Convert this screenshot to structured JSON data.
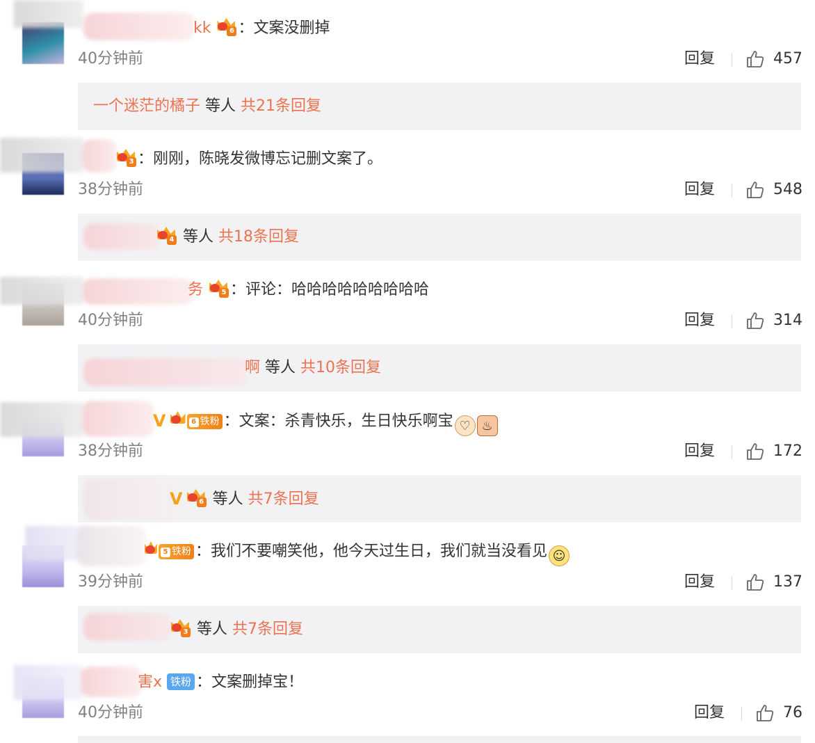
{
  "comments": [
    {
      "name_visible": "kk",
      "badge_level": "6",
      "text": "文案没删掉",
      "time": "40分钟前",
      "reply_label": "回复",
      "likes": "457",
      "reply_preview": {
        "name": "一个迷茫的橘子",
        "mid": "等人",
        "total": "共21条回复"
      }
    },
    {
      "name_visible": "",
      "badge_level": "3",
      "text": "刚刚，陈晓发微博忘记删文案了。",
      "time": "38分钟前",
      "reply_label": "回复",
      "likes": "548",
      "reply_preview": {
        "name": "",
        "badge_level": "4",
        "mid": "等人",
        "total": "共18条回复"
      }
    },
    {
      "name_visible": "务",
      "badge_level": "5",
      "text": "评论：哈哈哈哈哈哈哈哈哈",
      "time": "40分钟前",
      "reply_label": "回复",
      "likes": "314",
      "reply_preview": {
        "name": "啊",
        "mid": "等人",
        "total": "共10条回复"
      }
    },
    {
      "name_visible": "",
      "vip": "V",
      "badge_level": "6",
      "fan_badge": "铁粉",
      "text": "文案：杀青快乐，生日快乐啊宝",
      "emojis": [
        "kiss-emoji",
        "cake-emoji"
      ],
      "time": "38分钟前",
      "reply_label": "回复",
      "likes": "172",
      "reply_preview": {
        "name": "",
        "vip": "V",
        "badge_level": "6",
        "mid": "等人",
        "total": "共7条回复"
      }
    },
    {
      "name_visible": "",
      "badge_level": "5",
      "fan_badge": "铁粉",
      "text": "我们不要嘲笑他，他今天过生日，我们就当没看见",
      "emojis": [
        "dog-emoji"
      ],
      "time": "39分钟前",
      "reply_label": "回复",
      "likes": "137",
      "reply_preview": {
        "name": "",
        "badge_level": "3",
        "mid": "等人",
        "total": "共7条回复"
      }
    },
    {
      "name_visible": "害x",
      "iron_badge": "铁粉",
      "text": "文案删掉宝！",
      "time": "40分钟前",
      "reply_label": "回复",
      "likes": "76"
    }
  ],
  "colors": {
    "accent": "#eb7350",
    "reply_bg": "#f2f2f5",
    "time": "#808080",
    "crown": "#f5a623",
    "iron_badge": "#5aa7f0"
  },
  "icons": [
    "thumbs-up-icon",
    "crown-badge-icon",
    "vip-v-icon"
  ]
}
